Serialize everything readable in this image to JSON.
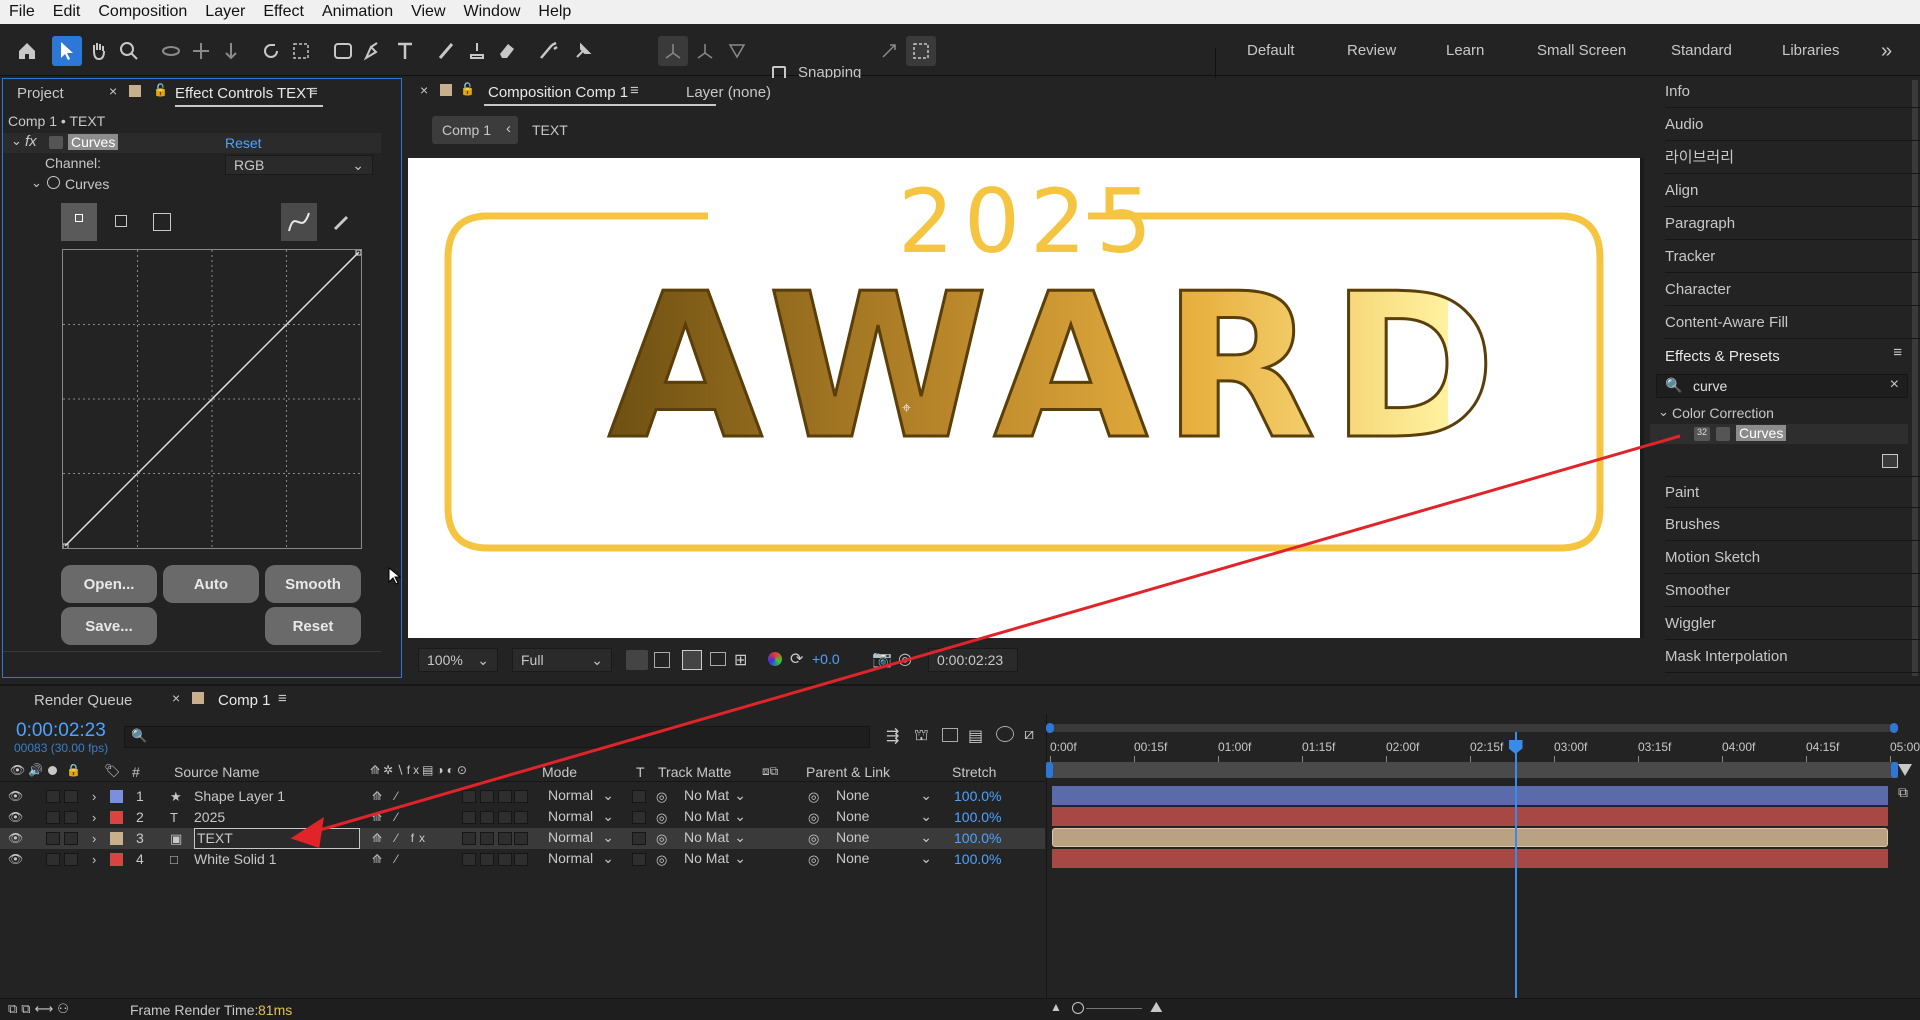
{
  "menu": [
    "File",
    "Edit",
    "Composition",
    "Layer",
    "Effect",
    "Animation",
    "View",
    "Window",
    "Help"
  ],
  "toolbar": {
    "snapping_label": "Snapping"
  },
  "workspaces": [
    "Default",
    "Review",
    "Learn",
    "Small Screen",
    "Standard",
    "Libraries"
  ],
  "workspaces_more": "»",
  "left_panel": {
    "tab_project": "Project",
    "tab_effect_controls": "Effect Controls TEXT",
    "breadcrumb": "Comp 1 • TEXT",
    "effect_name": "Curves",
    "reset_link": "Reset",
    "channel_label": "Channel:",
    "channel_value": "RGB",
    "curves_label": "Curves",
    "buttons": {
      "open": "Open...",
      "auto": "Auto",
      "smooth": "Smooth",
      "save": "Save...",
      "reset": "Reset"
    }
  },
  "viewer": {
    "tab_comp": "Composition Comp 1",
    "tab_layer": "Layer (none)",
    "crumb_comp": "Comp 1",
    "crumb_layer": "TEXT",
    "art_year": "2025",
    "art_title": "AWARD",
    "zoom": "100%",
    "resolution": "Full",
    "exposure": "+0.0",
    "timecode": "0:00:02:23"
  },
  "right_panel": {
    "items_top": [
      "Info",
      "Audio",
      "라이브러리",
      "Align",
      "Paragraph",
      "Tracker",
      "Character",
      "Content-Aware Fill"
    ],
    "effects_presets_title": "Effects & Presets",
    "search_value": "curve",
    "category": "Color Correction",
    "result": "Curves",
    "items_bottom": [
      "Paint",
      "Brushes",
      "Motion Sketch",
      "Smoother",
      "Wiggler",
      "Mask Interpolation"
    ]
  },
  "timeline": {
    "tab_render_queue": "Render Queue",
    "tab_comp": "Comp 1",
    "current_time": "0:00:02:23",
    "frame_info": "00083 (30.00 fps)",
    "columns": {
      "num": "#",
      "source": "Source Name",
      "mode": "Mode",
      "t": "T",
      "track_matte": "Track Matte",
      "parent": "Parent & Link",
      "stretch": "Stretch"
    },
    "ruler": [
      "0:00f",
      "00:15f",
      "01:00f",
      "01:15f",
      "02:00f",
      "02:15f",
      "03:00f",
      "03:15f",
      "04:00f",
      "04:15f",
      "05:00"
    ],
    "layers": [
      {
        "num": "1",
        "name": "Shape Layer 1",
        "mode": "Normal",
        "matte": "No Mat",
        "parent": "None",
        "stretch": "100.0%",
        "label_color": "#7b8fe0"
      },
      {
        "num": "2",
        "name": "2025",
        "mode": "Normal",
        "matte": "No Mat",
        "parent": "None",
        "stretch": "100.0%",
        "label_color": "#d8443f"
      },
      {
        "num": "3",
        "name": "TEXT",
        "mode": "Normal",
        "matte": "No Mat",
        "parent": "None",
        "stretch": "100.0%",
        "label_color": "#c8b08c"
      },
      {
        "num": "4",
        "name": "White Solid 1",
        "mode": "Normal",
        "matte": "No Mat",
        "parent": "None",
        "stretch": "100.0%",
        "label_color": "#d8443f"
      }
    ],
    "playhead_fraction": 0.553,
    "frame_render_label": "Frame Render Time:",
    "frame_render_value": "81ms"
  },
  "colors": {
    "accent": "#2d78d6",
    "gold": "#f5c542",
    "arrow": "#e0242a",
    "track_blue": "#5b6aaa",
    "track_red": "#a84845",
    "track_tan": "#b8a282"
  }
}
